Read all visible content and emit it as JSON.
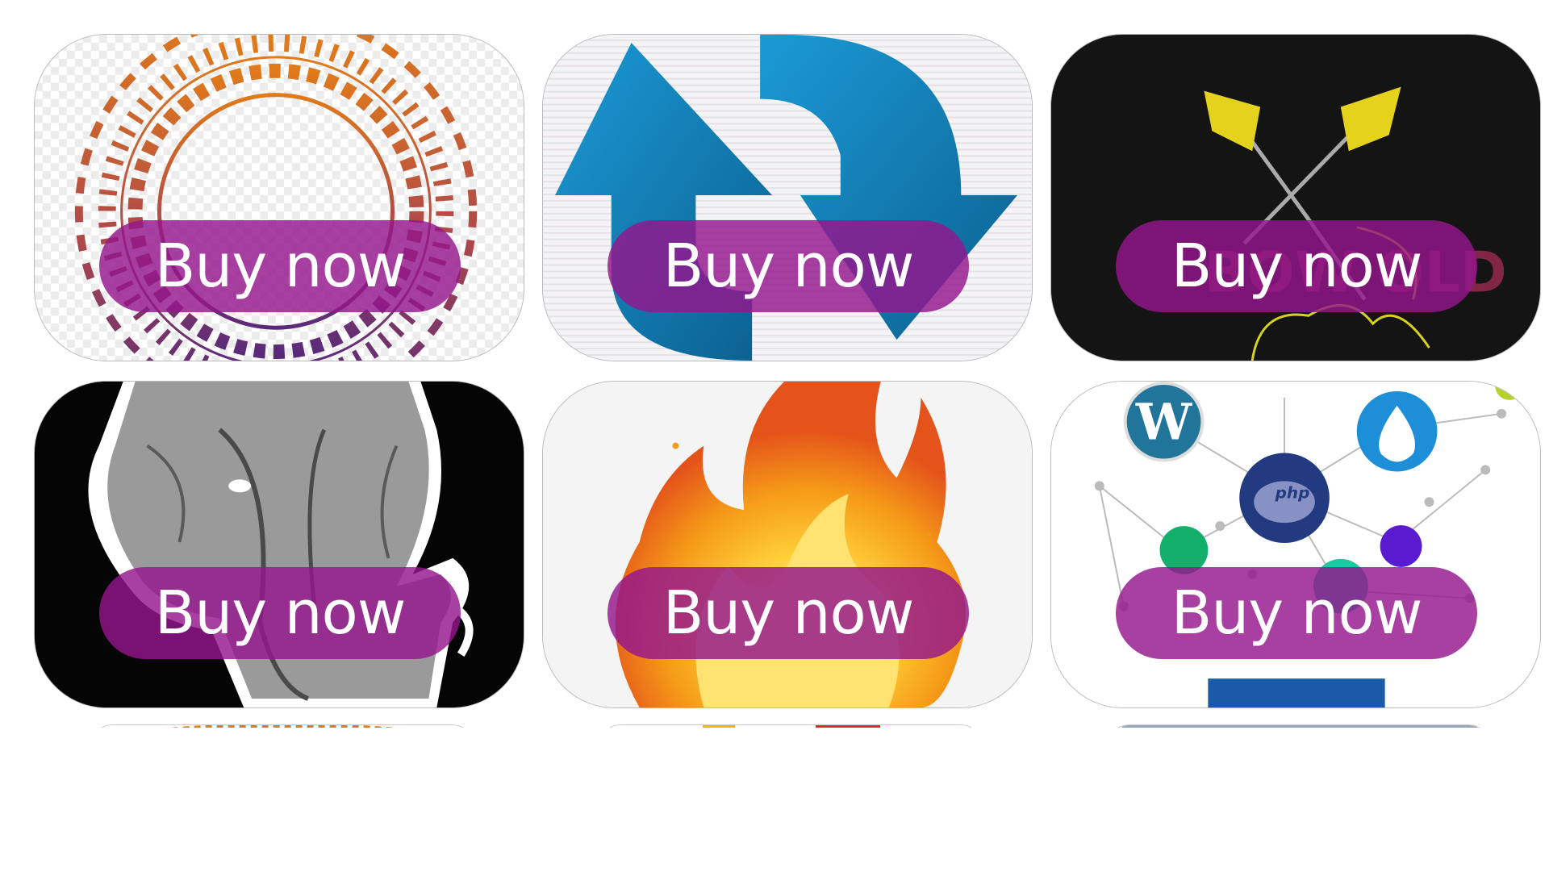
{
  "products": [
    {
      "art": "mandala-frame-image",
      "buy_label": "Buy now"
    },
    {
      "art": "refresh-arrows-image",
      "buy_label": "Buy now"
    },
    {
      "art": "crossed-arrows-image",
      "buy_label": "Buy now"
    },
    {
      "art": "elephant-image",
      "buy_label": "Buy now"
    },
    {
      "art": "fire-image",
      "buy_label": "Buy now"
    },
    {
      "art": "php-network-image",
      "buy_label": "Buy now"
    }
  ],
  "partial_row": [
    {
      "art": "mandala-partial-image"
    },
    {
      "art": "colorful-partial-image"
    },
    {
      "art": "pattern-partial-image"
    }
  ],
  "colors": {
    "button_bg": "#94168c",
    "button_text": "#ffffff",
    "card_border": "#b9b9b9"
  }
}
